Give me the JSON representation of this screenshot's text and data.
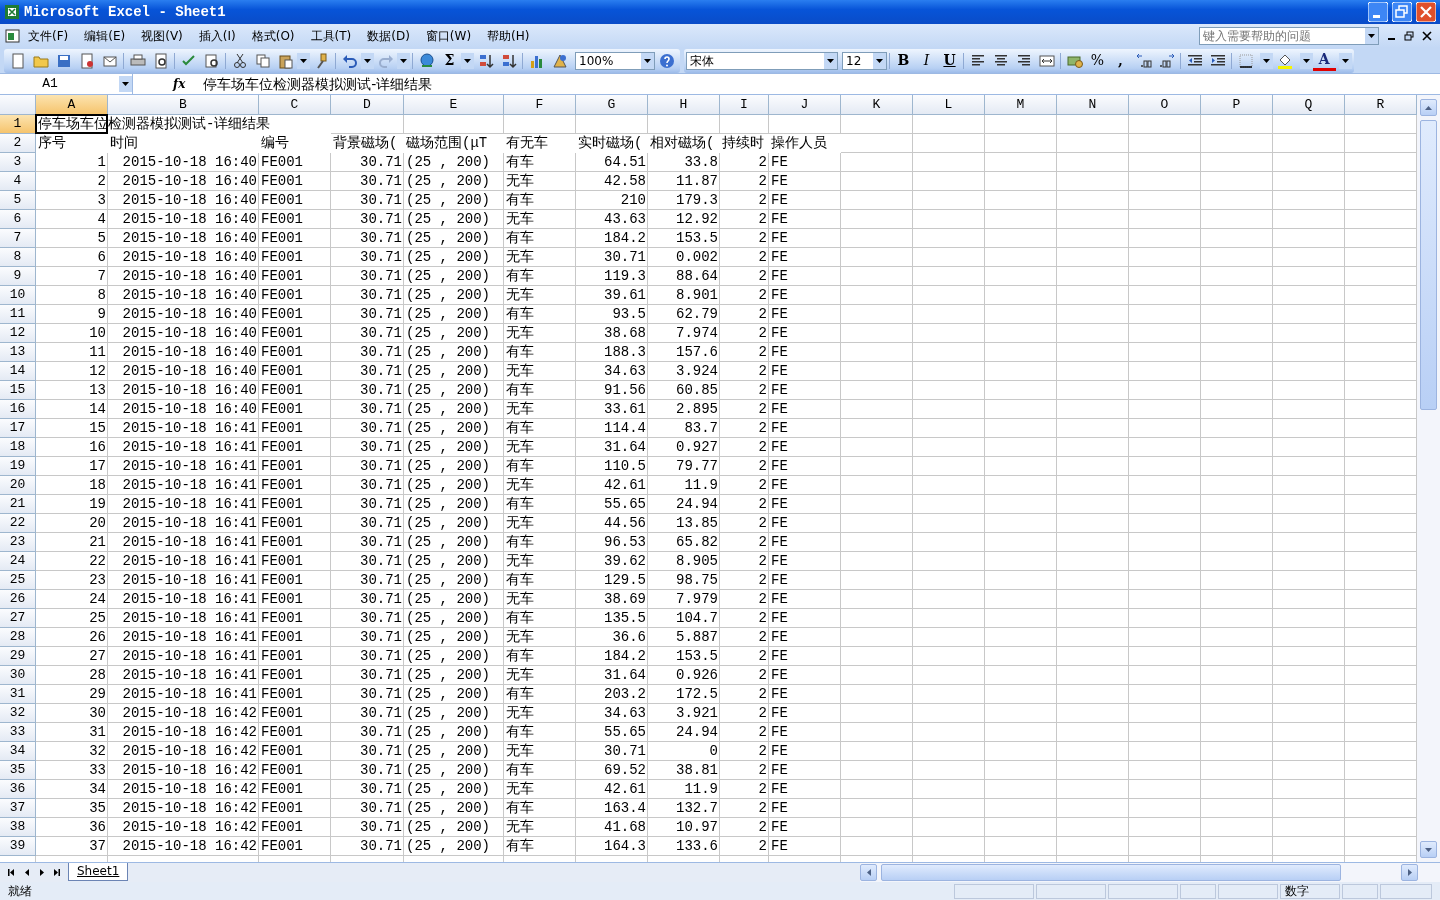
{
  "window": {
    "title": "Microsoft Excel - Sheet1"
  },
  "menu": [
    {
      "label": "文件(F)"
    },
    {
      "label": "编辑(E)"
    },
    {
      "label": "视图(V)"
    },
    {
      "label": "插入(I)"
    },
    {
      "label": "格式(O)"
    },
    {
      "label": "工具(T)"
    },
    {
      "label": "数据(D)"
    },
    {
      "label": "窗口(W)"
    },
    {
      "label": "帮助(H)"
    }
  ],
  "help_box": {
    "placeholder": "键入需要帮助的问题"
  },
  "standard_toolbar": {
    "autosum": "Σ",
    "zoom": "100%"
  },
  "formatting_toolbar": {
    "font": "宋体",
    "size": "12",
    "bold": "B",
    "italic": "I",
    "underline": "U",
    "percent": "%",
    "comma": ",",
    "font_color": "A"
  },
  "formula_bar": {
    "name_box": "A1",
    "fx": "fx",
    "value": "停车场车位检测器模拟测试-详细结果"
  },
  "sheet": {
    "columns": [
      {
        "label": "A",
        "selected": true
      },
      {
        "label": "B",
        "selected": false
      },
      {
        "label": "C",
        "selected": false
      },
      {
        "label": "D",
        "selected": false
      },
      {
        "label": "E",
        "selected": false
      },
      {
        "label": "F",
        "selected": false
      },
      {
        "label": "G",
        "selected": false
      },
      {
        "label": "H",
        "selected": false
      },
      {
        "label": "I",
        "selected": false
      },
      {
        "label": "J",
        "selected": false
      },
      {
        "label": "K",
        "selected": false
      },
      {
        "label": "L",
        "selected": false
      },
      {
        "label": "M",
        "selected": false
      },
      {
        "label": "N",
        "selected": false
      },
      {
        "label": "O",
        "selected": false
      },
      {
        "label": "P",
        "selected": false
      },
      {
        "label": "Q",
        "selected": false
      },
      {
        "label": "R",
        "selected": false
      }
    ],
    "rows": [
      {
        "number": "1",
        "selected": true,
        "kind": "title",
        "text": "停车场车位检测器模拟测试-详细结果"
      },
      {
        "number": "2",
        "selected": false,
        "kind": "header",
        "cells": [
          "序号",
          "时间",
          "编号",
          "背景磁场(",
          "磁场范围(μT",
          "有无车",
          "实时磁场(",
          "相对磁场(",
          "持续时",
          "操作人员"
        ]
      },
      {
        "number": "3",
        "selected": false,
        "kind": "data",
        "cells": [
          "1",
          "2015-10-18 16:40",
          "FE001",
          "30.71",
          "(25 , 200)",
          "有车",
          "64.51",
          "33.8",
          "2",
          "FE"
        ]
      },
      {
        "number": "4",
        "selected": false,
        "kind": "data",
        "cells": [
          "2",
          "2015-10-18 16:40",
          "FE001",
          "30.71",
          "(25 , 200)",
          "无车",
          "42.58",
          "11.87",
          "2",
          "FE"
        ]
      },
      {
        "number": "5",
        "selected": false,
        "kind": "data",
        "cells": [
          "3",
          "2015-10-18 16:40",
          "FE001",
          "30.71",
          "(25 , 200)",
          "有车",
          "210",
          "179.3",
          "2",
          "FE"
        ]
      },
      {
        "number": "6",
        "selected": false,
        "kind": "data",
        "cells": [
          "4",
          "2015-10-18 16:40",
          "FE001",
          "30.71",
          "(25 , 200)",
          "无车",
          "43.63",
          "12.92",
          "2",
          "FE"
        ]
      },
      {
        "number": "7",
        "selected": false,
        "kind": "data",
        "cells": [
          "5",
          "2015-10-18 16:40",
          "FE001",
          "30.71",
          "(25 , 200)",
          "有车",
          "184.2",
          "153.5",
          "2",
          "FE"
        ]
      },
      {
        "number": "8",
        "selected": false,
        "kind": "data",
        "cells": [
          "6",
          "2015-10-18 16:40",
          "FE001",
          "30.71",
          "(25 , 200)",
          "无车",
          "30.71",
          "0.002",
          "2",
          "FE"
        ]
      },
      {
        "number": "9",
        "selected": false,
        "kind": "data",
        "cells": [
          "7",
          "2015-10-18 16:40",
          "FE001",
          "30.71",
          "(25 , 200)",
          "有车",
          "119.3",
          "88.64",
          "2",
          "FE"
        ]
      },
      {
        "number": "10",
        "selected": false,
        "kind": "data",
        "cells": [
          "8",
          "2015-10-18 16:40",
          "FE001",
          "30.71",
          "(25 , 200)",
          "无车",
          "39.61",
          "8.901",
          "2",
          "FE"
        ]
      },
      {
        "number": "11",
        "selected": false,
        "kind": "data",
        "cells": [
          "9",
          "2015-10-18 16:40",
          "FE001",
          "30.71",
          "(25 , 200)",
          "有车",
          "93.5",
          "62.79",
          "2",
          "FE"
        ]
      },
      {
        "number": "12",
        "selected": false,
        "kind": "data",
        "cells": [
          "10",
          "2015-10-18 16:40",
          "FE001",
          "30.71",
          "(25 , 200)",
          "无车",
          "38.68",
          "7.974",
          "2",
          "FE"
        ]
      },
      {
        "number": "13",
        "selected": false,
        "kind": "data",
        "cells": [
          "11",
          "2015-10-18 16:40",
          "FE001",
          "30.71",
          "(25 , 200)",
          "有车",
          "188.3",
          "157.6",
          "2",
          "FE"
        ]
      },
      {
        "number": "14",
        "selected": false,
        "kind": "data",
        "cells": [
          "12",
          "2015-10-18 16:40",
          "FE001",
          "30.71",
          "(25 , 200)",
          "无车",
          "34.63",
          "3.924",
          "2",
          "FE"
        ]
      },
      {
        "number": "15",
        "selected": false,
        "kind": "data",
        "cells": [
          "13",
          "2015-10-18 16:40",
          "FE001",
          "30.71",
          "(25 , 200)",
          "有车",
          "91.56",
          "60.85",
          "2",
          "FE"
        ]
      },
      {
        "number": "16",
        "selected": false,
        "kind": "data",
        "cells": [
          "14",
          "2015-10-18 16:40",
          "FE001",
          "30.71",
          "(25 , 200)",
          "无车",
          "33.61",
          "2.895",
          "2",
          "FE"
        ]
      },
      {
        "number": "17",
        "selected": false,
        "kind": "data",
        "cells": [
          "15",
          "2015-10-18 16:41",
          "FE001",
          "30.71",
          "(25 , 200)",
          "有车",
          "114.4",
          "83.7",
          "2",
          "FE"
        ]
      },
      {
        "number": "18",
        "selected": false,
        "kind": "data",
        "cells": [
          "16",
          "2015-10-18 16:41",
          "FE001",
          "30.71",
          "(25 , 200)",
          "无车",
          "31.64",
          "0.927",
          "2",
          "FE"
        ]
      },
      {
        "number": "19",
        "selected": false,
        "kind": "data",
        "cells": [
          "17",
          "2015-10-18 16:41",
          "FE001",
          "30.71",
          "(25 , 200)",
          "有车",
          "110.5",
          "79.77",
          "2",
          "FE"
        ]
      },
      {
        "number": "20",
        "selected": false,
        "kind": "data",
        "cells": [
          "18",
          "2015-10-18 16:41",
          "FE001",
          "30.71",
          "(25 , 200)",
          "无车",
          "42.61",
          "11.9",
          "2",
          "FE"
        ]
      },
      {
        "number": "21",
        "selected": false,
        "kind": "data",
        "cells": [
          "19",
          "2015-10-18 16:41",
          "FE001",
          "30.71",
          "(25 , 200)",
          "有车",
          "55.65",
          "24.94",
          "2",
          "FE"
        ]
      },
      {
        "number": "22",
        "selected": false,
        "kind": "data",
        "cells": [
          "20",
          "2015-10-18 16:41",
          "FE001",
          "30.71",
          "(25 , 200)",
          "无车",
          "44.56",
          "13.85",
          "2",
          "FE"
        ]
      },
      {
        "number": "23",
        "selected": false,
        "kind": "data",
        "cells": [
          "21",
          "2015-10-18 16:41",
          "FE001",
          "30.71",
          "(25 , 200)",
          "有车",
          "96.53",
          "65.82",
          "2",
          "FE"
        ]
      },
      {
        "number": "24",
        "selected": false,
        "kind": "data",
        "cells": [
          "22",
          "2015-10-18 16:41",
          "FE001",
          "30.71",
          "(25 , 200)",
          "无车",
          "39.62",
          "8.905",
          "2",
          "FE"
        ]
      },
      {
        "number": "25",
        "selected": false,
        "kind": "data",
        "cells": [
          "23",
          "2015-10-18 16:41",
          "FE001",
          "30.71",
          "(25 , 200)",
          "有车",
          "129.5",
          "98.75",
          "2",
          "FE"
        ]
      },
      {
        "number": "26",
        "selected": false,
        "kind": "data",
        "cells": [
          "24",
          "2015-10-18 16:41",
          "FE001",
          "30.71",
          "(25 , 200)",
          "无车",
          "38.69",
          "7.979",
          "2",
          "FE"
        ]
      },
      {
        "number": "27",
        "selected": false,
        "kind": "data",
        "cells": [
          "25",
          "2015-10-18 16:41",
          "FE001",
          "30.71",
          "(25 , 200)",
          "有车",
          "135.5",
          "104.7",
          "2",
          "FE"
        ]
      },
      {
        "number": "28",
        "selected": false,
        "kind": "data",
        "cells": [
          "26",
          "2015-10-18 16:41",
          "FE001",
          "30.71",
          "(25 , 200)",
          "无车",
          "36.6",
          "5.887",
          "2",
          "FE"
        ]
      },
      {
        "number": "29",
        "selected": false,
        "kind": "data",
        "cells": [
          "27",
          "2015-10-18 16:41",
          "FE001",
          "30.71",
          "(25 , 200)",
          "有车",
          "184.2",
          "153.5",
          "2",
          "FE"
        ]
      },
      {
        "number": "30",
        "selected": false,
        "kind": "data",
        "cells": [
          "28",
          "2015-10-18 16:41",
          "FE001",
          "30.71",
          "(25 , 200)",
          "无车",
          "31.64",
          "0.926",
          "2",
          "FE"
        ]
      },
      {
        "number": "31",
        "selected": false,
        "kind": "data",
        "cells": [
          "29",
          "2015-10-18 16:41",
          "FE001",
          "30.71",
          "(25 , 200)",
          "有车",
          "203.2",
          "172.5",
          "2",
          "FE"
        ]
      },
      {
        "number": "32",
        "selected": false,
        "kind": "data",
        "cells": [
          "30",
          "2015-10-18 16:42",
          "FE001",
          "30.71",
          "(25 , 200)",
          "无车",
          "34.63",
          "3.921",
          "2",
          "FE"
        ]
      },
      {
        "number": "33",
        "selected": false,
        "kind": "data",
        "cells": [
          "31",
          "2015-10-18 16:42",
          "FE001",
          "30.71",
          "(25 , 200)",
          "有车",
          "55.65",
          "24.94",
          "2",
          "FE"
        ]
      },
      {
        "number": "34",
        "selected": false,
        "kind": "data",
        "cells": [
          "32",
          "2015-10-18 16:42",
          "FE001",
          "30.71",
          "(25 , 200)",
          "无车",
          "30.71",
          "0",
          "2",
          "FE"
        ]
      },
      {
        "number": "35",
        "selected": false,
        "kind": "data",
        "cells": [
          "33",
          "2015-10-18 16:42",
          "FE001",
          "30.71",
          "(25 , 200)",
          "有车",
          "69.52",
          "38.81",
          "2",
          "FE"
        ]
      },
      {
        "number": "36",
        "selected": false,
        "kind": "data",
        "cells": [
          "34",
          "2015-10-18 16:42",
          "FE001",
          "30.71",
          "(25 , 200)",
          "无车",
          "42.61",
          "11.9",
          "2",
          "FE"
        ]
      },
      {
        "number": "37",
        "selected": false,
        "kind": "data",
        "cells": [
          "35",
          "2015-10-18 16:42",
          "FE001",
          "30.71",
          "(25 , 200)",
          "有车",
          "163.4",
          "132.7",
          "2",
          "FE"
        ]
      },
      {
        "number": "38",
        "selected": false,
        "kind": "data",
        "cells": [
          "36",
          "2015-10-18 16:42",
          "FE001",
          "30.71",
          "(25 , 200)",
          "无车",
          "41.68",
          "10.97",
          "2",
          "FE"
        ]
      },
      {
        "number": "39",
        "selected": false,
        "kind": "data",
        "cells": [
          "37",
          "2015-10-18 16:42",
          "FE001",
          "30.71",
          "(25 , 200)",
          "有车",
          "164.3",
          "133.6",
          "2",
          "FE"
        ]
      }
    ]
  },
  "sheet_tabs": [
    {
      "label": "Sheet1",
      "selected": true
    }
  ],
  "status_bar": {
    "status": "就绪",
    "indicator": "数字"
  }
}
